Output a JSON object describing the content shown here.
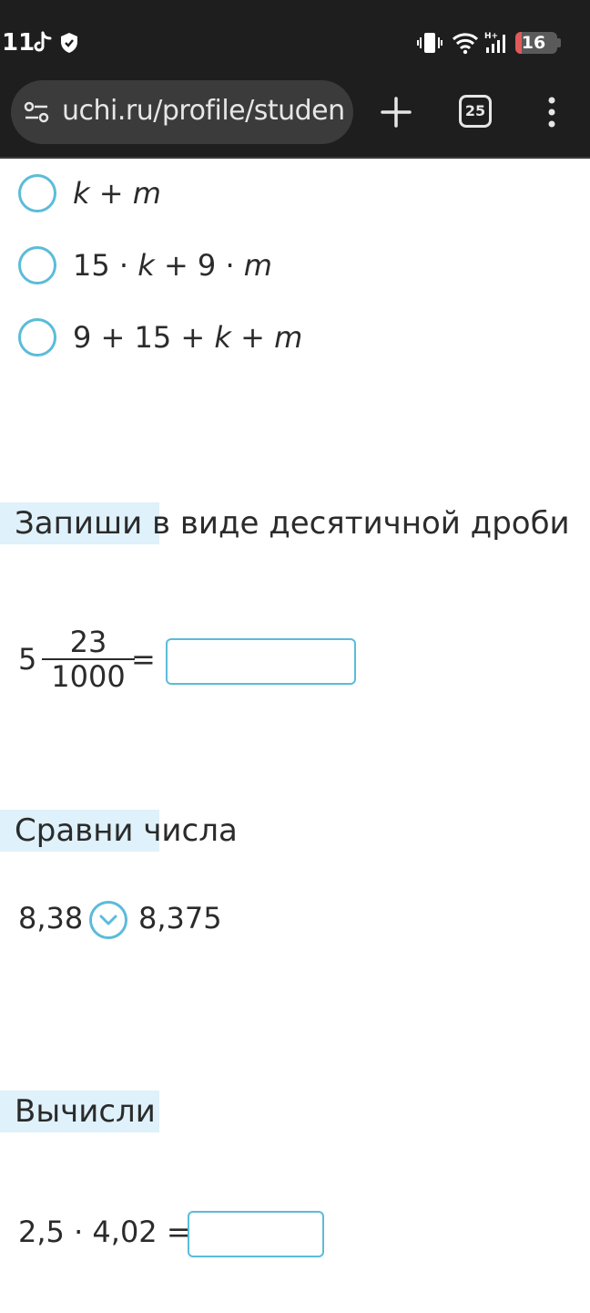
{
  "status_bar": {
    "time": "11",
    "battery_level": "16",
    "icons": [
      "tiktok-icon",
      "shield-icon",
      "vibrate-icon",
      "wifi-icon",
      "signal-icon",
      "battery-icon"
    ]
  },
  "browser": {
    "url": "uchi.ru/profile/studen",
    "tab_count": "25",
    "icons": [
      "site-settings-icon",
      "plus-icon",
      "tabs-icon",
      "more-vert-icon"
    ]
  },
  "options": [
    {
      "parts": [
        {
          "t": "k",
          "i": true
        },
        {
          "t": " + ",
          "i": false
        },
        {
          "t": "m",
          "i": true
        }
      ]
    },
    {
      "parts": [
        {
          "t": "15 · ",
          "i": false
        },
        {
          "t": "k",
          "i": true
        },
        {
          "t": " + 9 · ",
          "i": false
        },
        {
          "t": "m",
          "i": true
        }
      ]
    },
    {
      "parts": [
        {
          "t": "9 + 15 + ",
          "i": false
        },
        {
          "t": "k",
          "i": true
        },
        {
          "t": " + ",
          "i": false
        },
        {
          "t": "m",
          "i": true
        }
      ]
    }
  ],
  "task_decimal": {
    "heading": "Запиши в виде десятичной дроби",
    "whole": "5",
    "numerator": "23",
    "denominator": "1000",
    "equals": "=",
    "answer": ""
  },
  "task_compare": {
    "heading": "Сравни числа",
    "left": "8,38",
    "right": "8,375",
    "selected": ""
  },
  "task_calc": {
    "heading": "Вычисли",
    "expression": "2,5 · 4,02 =",
    "answer": ""
  },
  "colors": {
    "accent": "#5bbcd9",
    "heading_highlight": "#dff1fa",
    "bar_bg": "#1e1e1e",
    "battery_low": "#e05a5a"
  }
}
